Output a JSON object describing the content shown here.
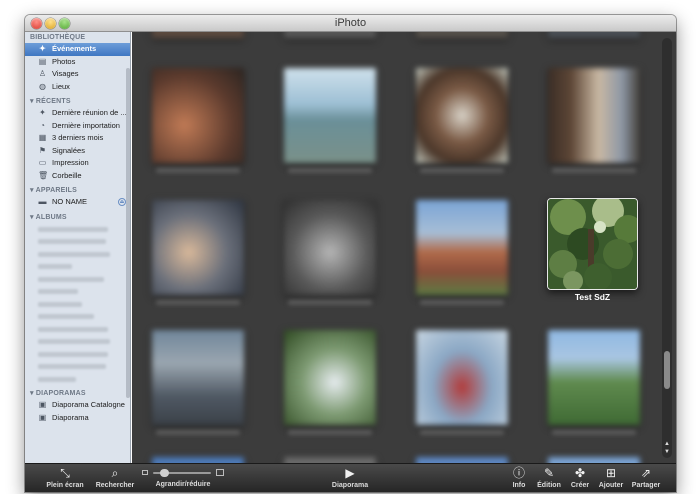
{
  "window": {
    "title": "iPhoto"
  },
  "sidebar": {
    "sections": {
      "bibliotheque": "BIBLIOTHÈQUE",
      "recents": "RÉCENTS",
      "appareils": "APPAREILS",
      "albums": "ALBUMS",
      "diaporamas": "DIAPORAMAS"
    },
    "library": [
      {
        "label": "Événements",
        "icon": "events-icon"
      },
      {
        "label": "Photos",
        "icon": "photos-icon"
      },
      {
        "label": "Visages",
        "icon": "faces-icon"
      },
      {
        "label": "Lieux",
        "icon": "places-icon"
      }
    ],
    "recents": [
      {
        "label": "Dernière réunion de ...",
        "icon": "event-icon"
      },
      {
        "label": "Dernière importation",
        "icon": "import-icon"
      },
      {
        "label": "3 derniers mois",
        "icon": "calendar-icon"
      },
      {
        "label": "Signalées",
        "icon": "flag-icon"
      },
      {
        "label": "Impression",
        "icon": "print-icon"
      },
      {
        "label": "Corbeille",
        "icon": "trash-icon"
      }
    ],
    "devices": [
      {
        "label": "NO NAME",
        "icon": "disk-icon"
      }
    ],
    "slideshows": [
      {
        "label": "Diaporama Catalogne",
        "icon": "slideshow-icon"
      },
      {
        "label": "Diaporama",
        "icon": "slideshow-icon"
      }
    ]
  },
  "content": {
    "focused_event_title": "Test SdZ"
  },
  "toolbar": {
    "fullscreen": "Plein écran",
    "search": "Rechercher",
    "zoom": "Agrandir/réduire",
    "zoom_level": 0.15,
    "slideshow": "Diaporama",
    "info": "Info",
    "edit": "Édition",
    "create": "Créer",
    "add": "Ajouter",
    "share": "Partager"
  }
}
